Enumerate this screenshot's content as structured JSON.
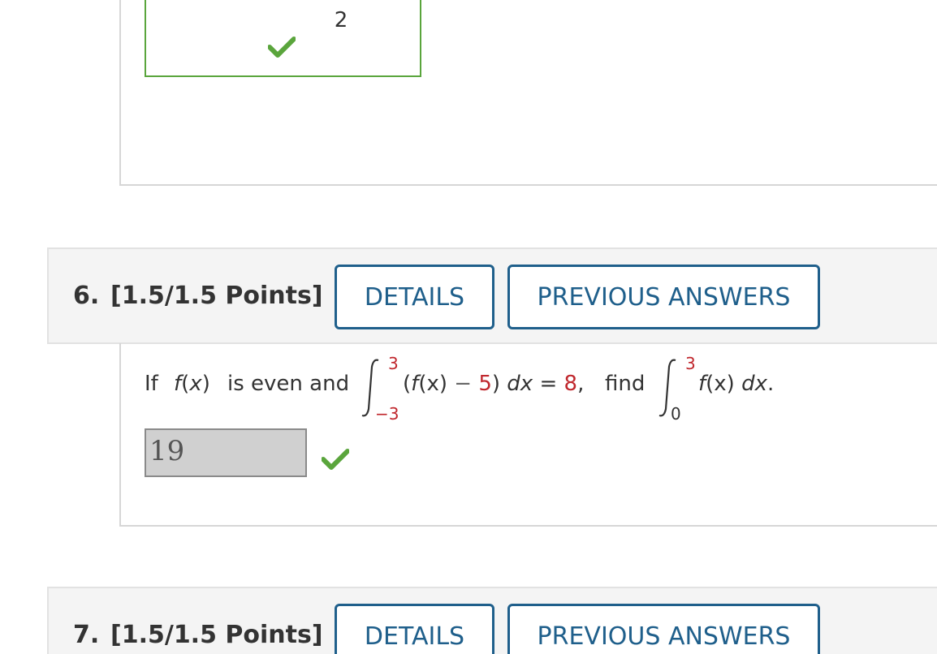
{
  "q5": {
    "answer_value": "2",
    "status_icon": "checkmark-icon"
  },
  "q6": {
    "number": "6.",
    "points": "[1.5/1.5 Points]",
    "details_label": "DETAILS",
    "previous_answers_label": "PREVIOUS ANSWERS",
    "statement": {
      "if_text": "If",
      "fx": "f",
      "paren_open": "(",
      "x": "x",
      "paren_close": ")",
      "even_text": "is even and",
      "integral1_upper": "3",
      "integral1_lower": "−3",
      "integrand_open": "(",
      "integrand_f": "f",
      "integrand_x": "(x)",
      "minus": "−",
      "const": "5",
      "integrand_close": ")",
      "dx": "dx",
      "equals": "=",
      "result": "8",
      "comma": ",",
      "find_text": "find",
      "integral2_upper": "3",
      "integral2_lower": "0",
      "integrand2_f": "f",
      "integrand2_x": "(x)",
      "dx2": "dx",
      "period": "."
    },
    "answer_value": "19",
    "status_icon": "checkmark-icon"
  },
  "q7": {
    "number": "7.",
    "points": "[1.5/1.5 Points]",
    "details_label": "DETAILS",
    "previous_answers_label": "PREVIOUS ANSWERS"
  },
  "colors": {
    "accent": "#1f5f8b",
    "correct": "#5aa53c",
    "highlight_red": "#c0272d"
  }
}
